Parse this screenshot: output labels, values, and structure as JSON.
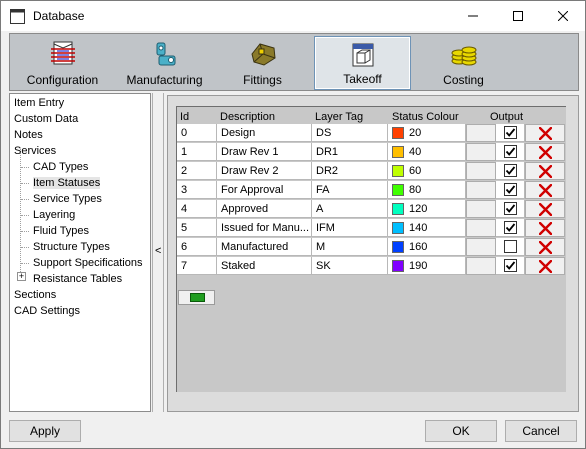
{
  "window": {
    "title": "Database"
  },
  "toolbar": {
    "items": [
      {
        "label": "Configuration",
        "icon": "configuration-icon",
        "active": false
      },
      {
        "label": "Manufacturing",
        "icon": "manufacturing-icon",
        "active": false
      },
      {
        "label": "Fittings",
        "icon": "fittings-icon",
        "active": false
      },
      {
        "label": "Takeoff",
        "icon": "takeoff-icon",
        "active": true
      },
      {
        "label": "Costing",
        "icon": "costing-icon",
        "active": false
      }
    ]
  },
  "tree": {
    "items": [
      {
        "label": "Item Entry",
        "level": 0
      },
      {
        "label": "Custom Data",
        "level": 0
      },
      {
        "label": "Notes",
        "level": 0
      },
      {
        "label": "Services",
        "level": 0
      },
      {
        "label": "CAD Types",
        "level": 1
      },
      {
        "label": "Item Statuses",
        "level": 1,
        "selected": true
      },
      {
        "label": "Service Types",
        "level": 1
      },
      {
        "label": "Layering",
        "level": 1
      },
      {
        "label": "Fluid Types",
        "level": 1
      },
      {
        "label": "Structure Types",
        "level": 1
      },
      {
        "label": "Support Specifications",
        "level": 1
      },
      {
        "label": "Resistance Tables",
        "level": 1,
        "expander": "+"
      },
      {
        "label": "Sections",
        "level": 0
      },
      {
        "label": "CAD Settings",
        "level": 0
      }
    ]
  },
  "splitter": {
    "glyph": "<"
  },
  "grid": {
    "headers": {
      "id": "Id",
      "description": "Description",
      "layer_tag": "Layer Tag",
      "status_colour": "Status Colour",
      "output": "Output"
    },
    "rows": [
      {
        "id": "0",
        "description": "Design",
        "layer_tag": "DS",
        "colour_num": "20",
        "colour": "#ff4000",
        "output": true
      },
      {
        "id": "1",
        "description": "Draw Rev 1",
        "layer_tag": "DR1",
        "colour_num": "40",
        "colour": "#ffbf00",
        "output": true
      },
      {
        "id": "2",
        "description": "Draw Rev 2",
        "layer_tag": "DR2",
        "colour_num": "60",
        "colour": "#bfff00",
        "output": true
      },
      {
        "id": "3",
        "description": "For Approval",
        "layer_tag": "FA",
        "colour_num": "80",
        "colour": "#40ff00",
        "output": true
      },
      {
        "id": "4",
        "description": "Approved",
        "layer_tag": "A",
        "colour_num": "120",
        "colour": "#00ffbf",
        "output": true
      },
      {
        "id": "5",
        "description": "Issued for Manu...",
        "layer_tag": "IFM",
        "colour_num": "140",
        "colour": "#00bfff",
        "output": true
      },
      {
        "id": "6",
        "description": "Manufactured",
        "layer_tag": "M",
        "colour_num": "160",
        "colour": "#0040ff",
        "output": false
      },
      {
        "id": "7",
        "description": "Staked",
        "layer_tag": "SK",
        "colour_num": "190",
        "colour": "#8000ff",
        "output": true
      }
    ]
  },
  "buttons": {
    "apply": "Apply",
    "ok": "OK",
    "cancel": "Cancel"
  }
}
